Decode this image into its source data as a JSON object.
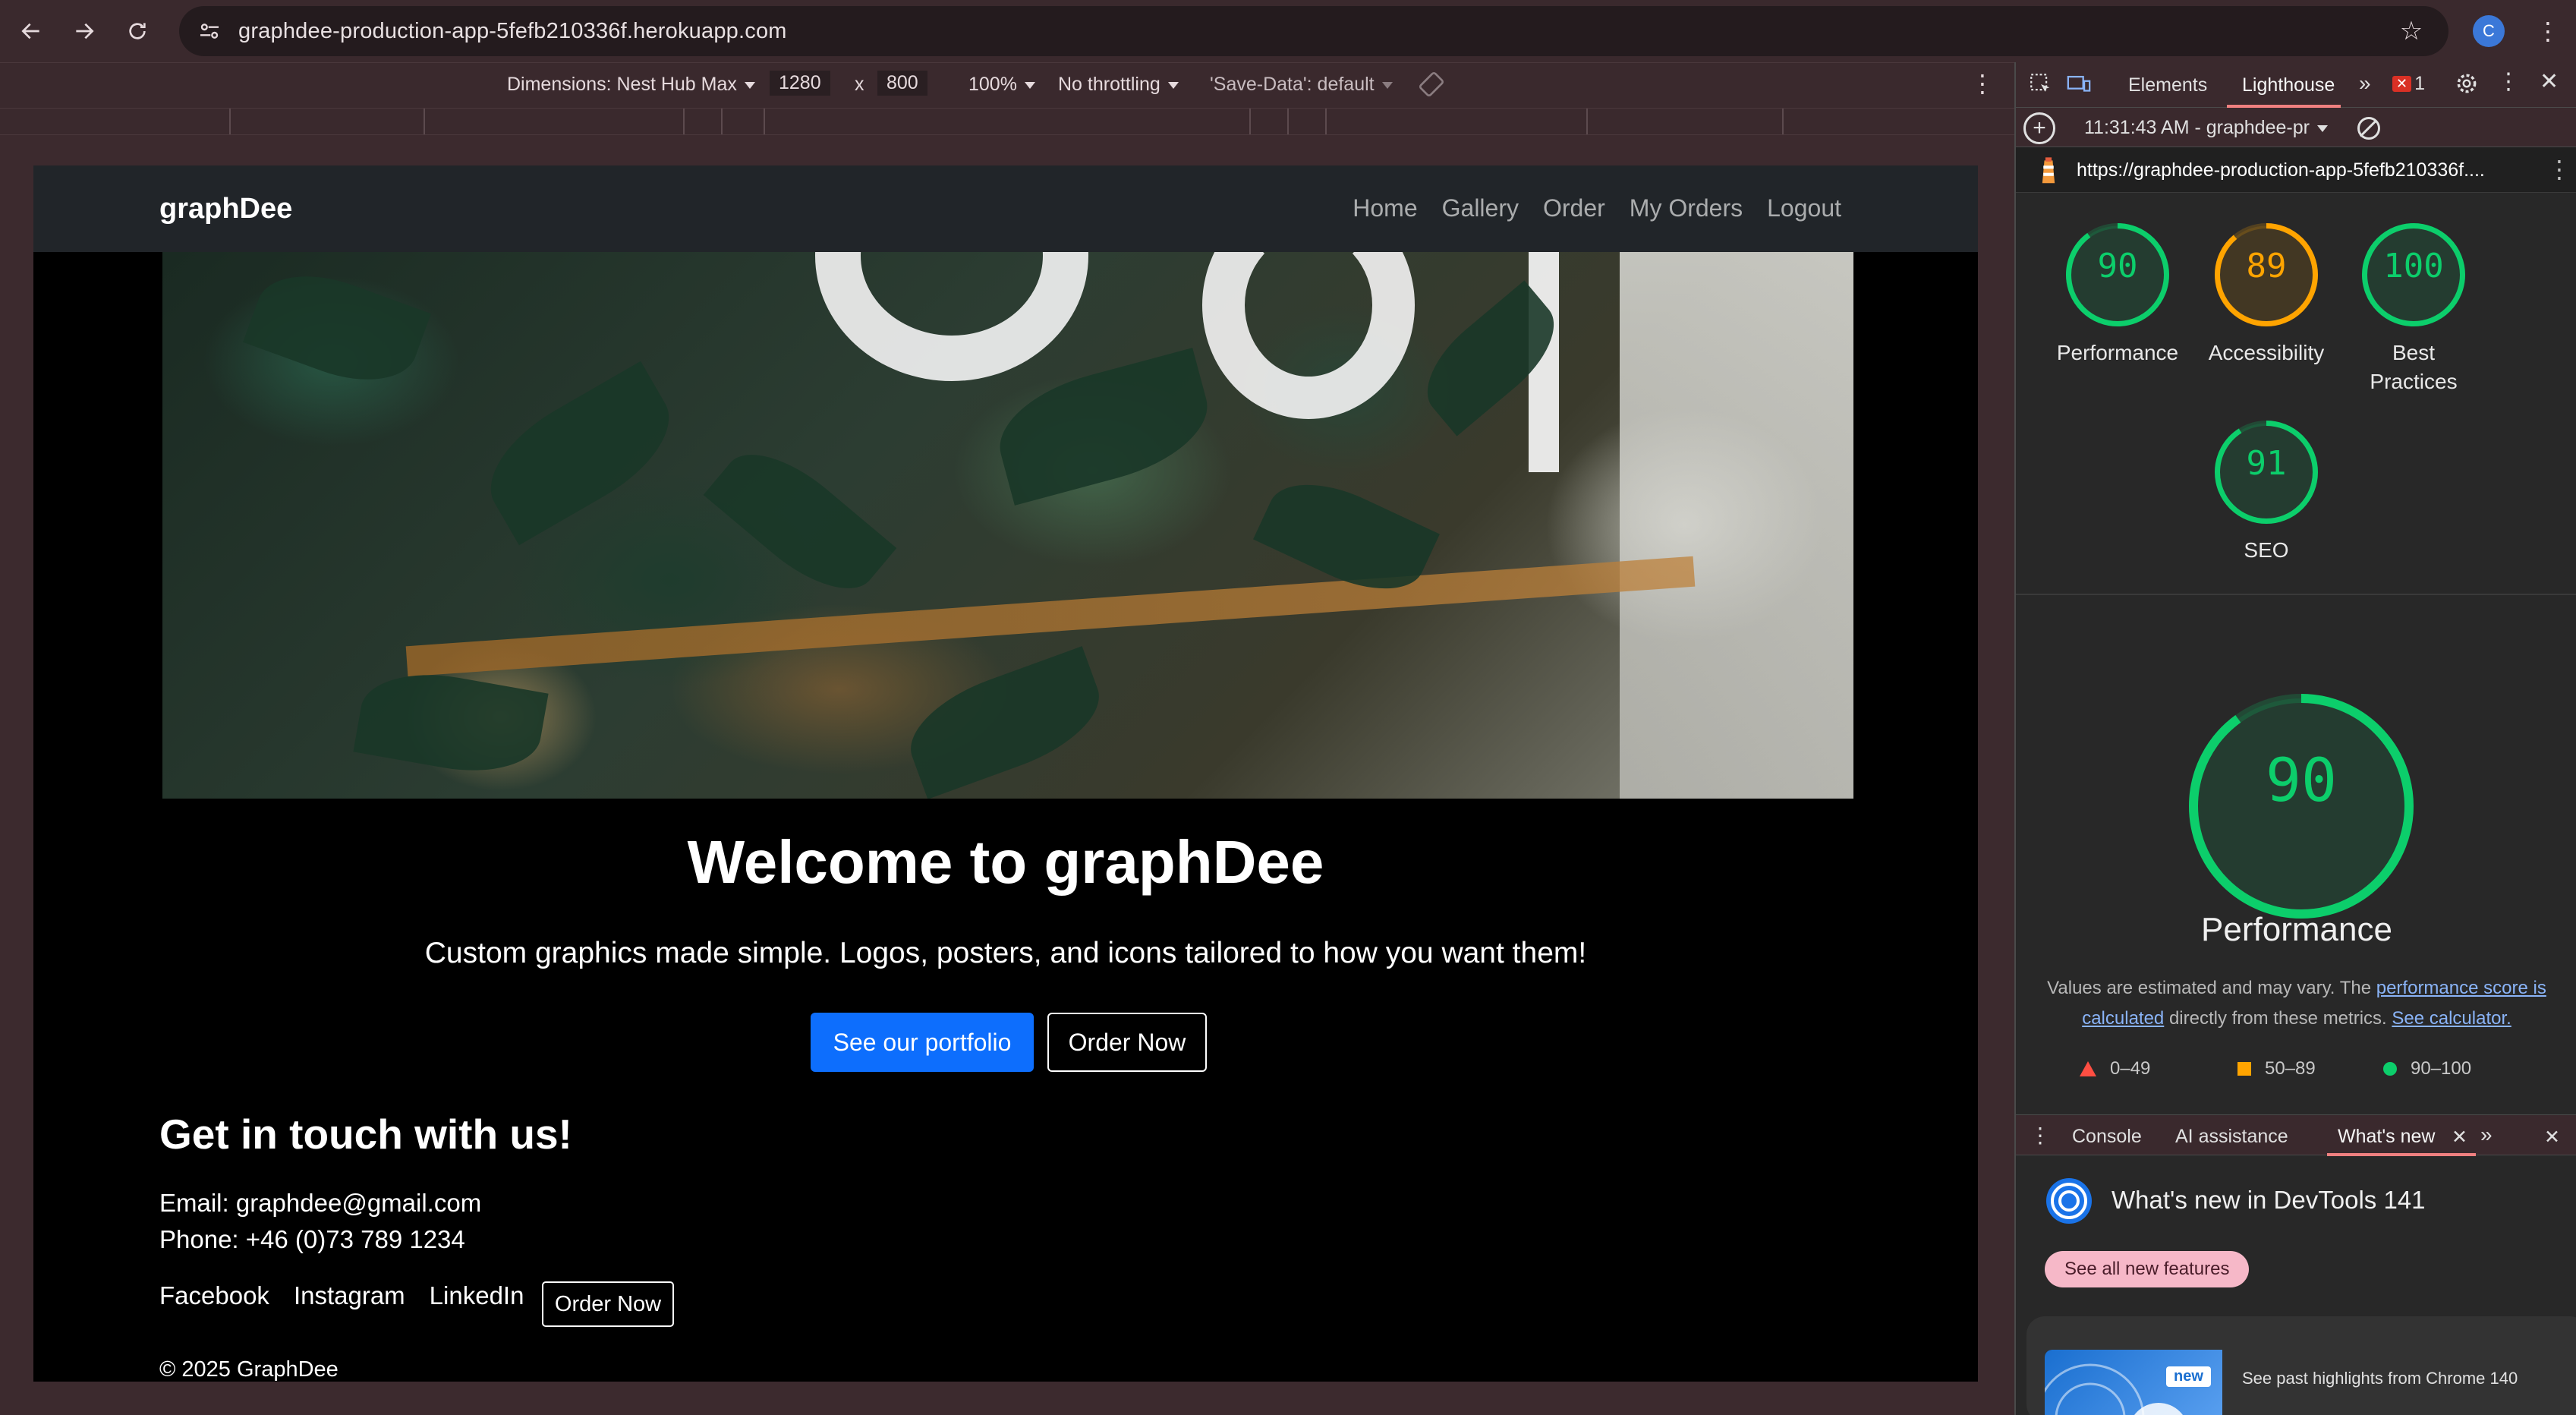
{
  "browser": {
    "url": "graphdee-production-app-5fefb210336f.herokuapp.com",
    "profile_initial": "C"
  },
  "device_toolbar": {
    "dimensions_label": "Dimensions: Nest Hub Max",
    "width": "1280",
    "times": "x",
    "height": "800",
    "zoom": "100%",
    "throttling": "No throttling",
    "save_data": "'Save-Data': default"
  },
  "site": {
    "brand": "graphDee",
    "nav": [
      "Home",
      "Gallery",
      "Order",
      "My Orders",
      "Logout"
    ],
    "welcome": "Welcome to graphDee",
    "tagline": "Custom graphics made simple. Logos, posters, and icons tailored to how you want them!",
    "btn_portfolio": "See our portfolio",
    "btn_order": "Order Now",
    "contact_heading": "Get in touch with us!",
    "email": "Email: graphdee@gmail.com",
    "phone": "Phone: +46 (0)73 789 1234",
    "social": [
      "Facebook",
      "Instagram",
      "LinkedIn"
    ],
    "btn_order_footer": "Order Now",
    "copyright": "© 2025 GraphDee"
  },
  "devtools": {
    "tabs": {
      "elements": "Elements",
      "lighthouse": "Lighthouse",
      "more": "»",
      "error_count": "1"
    },
    "lighthouse": {
      "report_time": "11:31:43 AM - graphdee-pr",
      "report_url": "https://graphdee-production-app-5fefb210336f....",
      "scores": [
        {
          "value": 90,
          "label": "Performance",
          "color": "#0cce6b"
        },
        {
          "value": 89,
          "label": "Accessibility",
          "color": "#ffa400"
        },
        {
          "value": 100,
          "label": "Best Practices",
          "color": "#0cce6b"
        },
        {
          "value": 91,
          "label": "SEO",
          "color": "#0cce6b"
        }
      ],
      "perf_big_value": 90,
      "perf_big_label": "Performance",
      "note_prefix": "Values are estimated and may vary. The",
      "note_link1": "performance score is calculated",
      "note_middle": "directly from these metrics.",
      "note_link2": "See calculator.",
      "legend": [
        {
          "range": "0–49",
          "shape": "triangle",
          "color": "#ff4e42"
        },
        {
          "range": "50–89",
          "shape": "square",
          "color": "#ffa400"
        },
        {
          "range": "90–100",
          "shape": "circle",
          "color": "#0cce6b"
        }
      ]
    },
    "drawer": {
      "tabs": [
        "Console",
        "AI assistance",
        "What's new"
      ],
      "whats_new_title": "What's new in DevTools 141",
      "see_all": "See all new features",
      "badge": "new",
      "card_text": "See past highlights from Chrome 140"
    }
  }
}
